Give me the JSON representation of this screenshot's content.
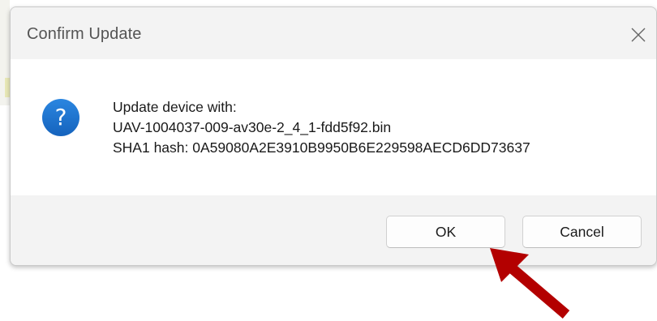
{
  "dialog": {
    "title": "Confirm Update",
    "icon": "question-icon",
    "message": {
      "line1": "Update device with:",
      "line2": "UAV-1004037-009-av30e-2_4_1-fdd5f92.bin",
      "line3": "SHA1 hash: 0A59080A2E3910B9950B6E229598AECD6DD73637"
    },
    "buttons": {
      "ok_label": "OK",
      "cancel_label": "Cancel"
    }
  },
  "annotation": {
    "arrow_color": "#b30000",
    "points_to": "ok-button"
  },
  "colors": {
    "icon_blue": "#1a73d0",
    "dialog_bg": "#f3f3f3",
    "content_bg": "#ffffff"
  }
}
